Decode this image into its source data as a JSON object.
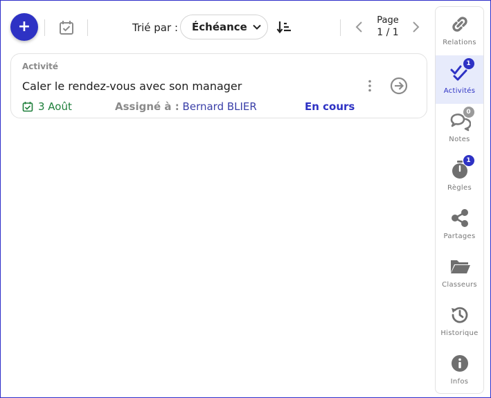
{
  "toolbar": {
    "add_label": "+",
    "sort_by_label": "Trié par :",
    "sort_value": "Échéance",
    "page_label": "Page",
    "page_value": "1 / 1"
  },
  "activity": {
    "type": "Activité",
    "title": "Caler le rendez-vous avec son manager",
    "date": "3 Août",
    "assigned_label": "Assigné à :",
    "assignee": "Bernard BLIER",
    "status": "En cours"
  },
  "sidebar": {
    "items": [
      {
        "label": "Relations",
        "icon": "link-icon"
      },
      {
        "label": "Activités",
        "icon": "double-check-icon",
        "badge": "1",
        "badge_color": "#2e32c4",
        "active": true
      },
      {
        "label": "Notes",
        "icon": "chat-bubbles-icon",
        "badge": "0",
        "badge_color": "#9a9a9a"
      },
      {
        "label": "Règles",
        "icon": "stopwatch-icon",
        "badge": "1",
        "badge_color": "#2e32c4"
      },
      {
        "label": "Partages",
        "icon": "share-icon"
      },
      {
        "label": "Classeurs",
        "icon": "folder-icon"
      },
      {
        "label": "Historique",
        "icon": "history-icon"
      },
      {
        "label": "Infos",
        "icon": "info-icon"
      }
    ]
  },
  "colors": {
    "accent": "#2e32c4",
    "success": "#1e7f3a",
    "muted": "#8a8a8a",
    "active_bg": "#e7ebfb"
  }
}
